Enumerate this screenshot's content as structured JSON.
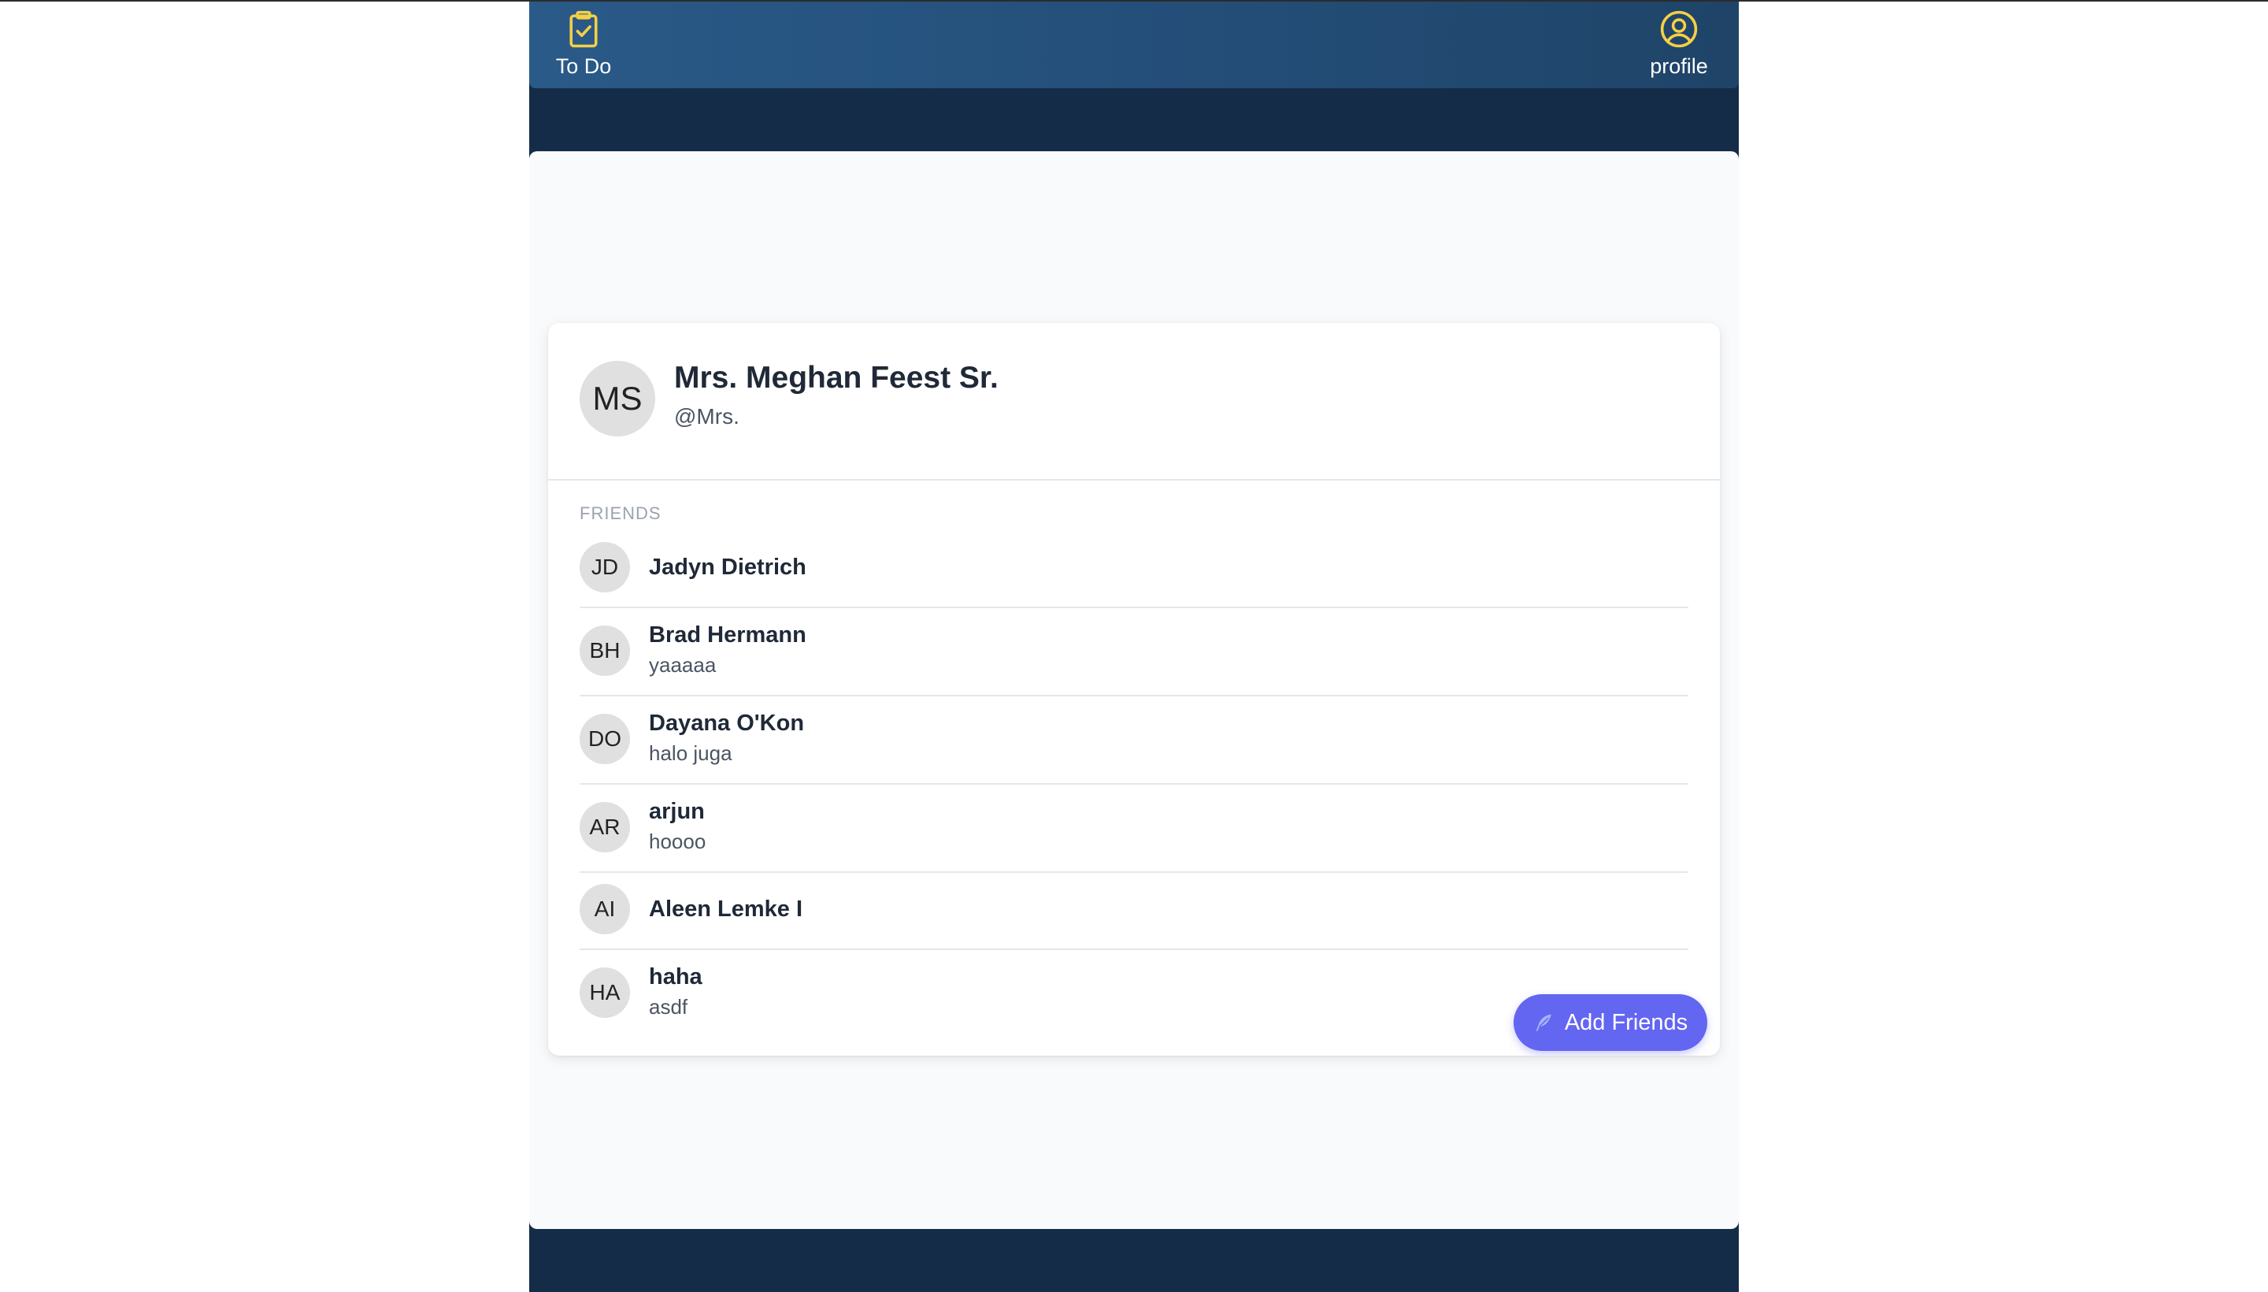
{
  "nav": {
    "todo": {
      "label": "To Do",
      "icon": "clipboard-check-icon"
    },
    "profile": {
      "label": "profile",
      "icon": "user-circle-icon"
    },
    "accent_color": "#f5cf45"
  },
  "profile": {
    "initials": "MS",
    "name": "Mrs. Meghan Feest Sr.",
    "handle": "@Mrs."
  },
  "friends": {
    "heading": "FRIENDS",
    "items": [
      {
        "initials": "JD",
        "name": "Jadyn Dietrich",
        "status": ""
      },
      {
        "initials": "BH",
        "name": "Brad Hermann",
        "status": "yaaaaa"
      },
      {
        "initials": "DO",
        "name": "Dayana O'Kon",
        "status": "halo juga"
      },
      {
        "initials": "AR",
        "name": "arjun",
        "status": "hoooo"
      },
      {
        "initials": "AI",
        "name": "Aleen Lemke I",
        "status": ""
      },
      {
        "initials": "HA",
        "name": "haha",
        "status": "asdf"
      }
    ]
  },
  "actions": {
    "add_friends_label": "Add Friends",
    "add_friends_icon": "feather-icon",
    "button_color": "#6366f1"
  }
}
